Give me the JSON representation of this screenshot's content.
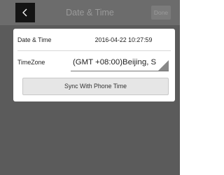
{
  "header": {
    "title": "Date & Time",
    "done_label": "Done",
    "back_icon": "chevron-left-icon"
  },
  "settings": {
    "datetime_label": "Date & Time",
    "datetime_value": "2016-04-22 10:27:59",
    "timezone_label": "TimeZone",
    "timezone_value": "(GMT +08:00)Beijing, S",
    "sync_label": "Sync With Phone Time"
  },
  "colors": {
    "background": "#5b5b5b",
    "header": "#6c6c6c",
    "card": "#ffffff"
  }
}
